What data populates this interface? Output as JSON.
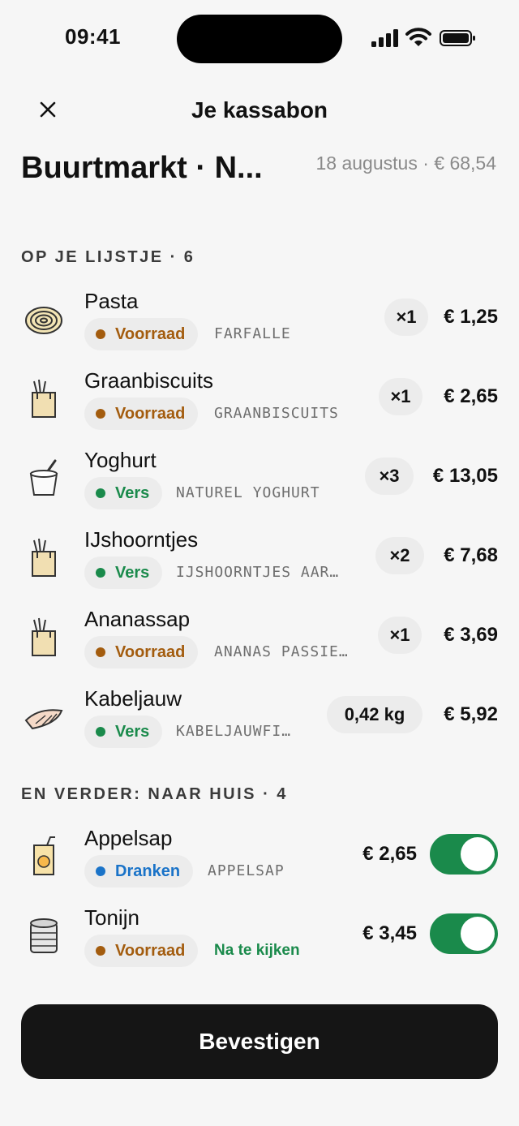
{
  "status_bar": {
    "time": "09:41"
  },
  "header": {
    "title": "Je kassabon",
    "close_icon": "close-icon"
  },
  "receipt": {
    "store": "Buurtmarkt · N...",
    "meta": "18 augustus · € 68,54"
  },
  "list_section": {
    "title": "OP JE LIJSTJE · 6"
  },
  "list_items": [
    {
      "name": "Pasta",
      "tag": "Voorraad",
      "tag_color": "#a35c0e",
      "detail": "FARFALLE",
      "qty": "×1",
      "price": "€ 1,25",
      "icon": "pasta-icon"
    },
    {
      "name": "Graanbiscuits",
      "tag": "Voorraad",
      "tag_color": "#a35c0e",
      "detail": "GRAANBISCUITS",
      "qty": "×1",
      "price": "€ 2,65",
      "icon": "grocery-bag-icon"
    },
    {
      "name": "Yoghurt",
      "tag": "Vers",
      "tag_color": "#1a8a4b",
      "detail": "NATUREL YOGHURT",
      "qty": "×3",
      "price": "€ 13,05",
      "icon": "yoghurt-icon"
    },
    {
      "name": "IJshoorntjes",
      "tag": "Vers",
      "tag_color": "#1a8a4b",
      "detail": "IJSHOORNTJES AAR…",
      "qty": "×2",
      "price": "€ 7,68",
      "icon": "grocery-bag-icon"
    },
    {
      "name": "Ananassap",
      "tag": "Voorraad",
      "tag_color": "#a35c0e",
      "detail": "ANANAS PASSIE…",
      "qty": "×1",
      "price": "€ 3,69",
      "icon": "grocery-bag-icon"
    },
    {
      "name": "Kabeljauw",
      "tag": "Vers",
      "tag_color": "#1a8a4b",
      "detail": "KABELJAUWFI…",
      "qty": "0,42 kg",
      "price": "€ 5,92",
      "icon": "fish-icon"
    }
  ],
  "extra_section": {
    "title": "EN VERDER: NAAR HUIS · 4"
  },
  "extra_items": [
    {
      "name": "Appelsap",
      "tag": "Dranken",
      "tag_color": "#1a73c8",
      "detail": "APPELSAP",
      "price": "€ 2,65",
      "toggle_on": true,
      "icon": "juice-box-icon"
    },
    {
      "name": "Tonijn",
      "tag": "Voorraad",
      "tag_color": "#a35c0e",
      "flag": "Na te kijken",
      "price": "€ 3,45",
      "toggle_on": true,
      "icon": "tin-can-icon"
    }
  ],
  "cta": {
    "label": "Bevestigen"
  },
  "colors": {
    "accent_green": "#1a8a4b",
    "stock_brown": "#a35c0e",
    "drinks_blue": "#1a73c8"
  }
}
